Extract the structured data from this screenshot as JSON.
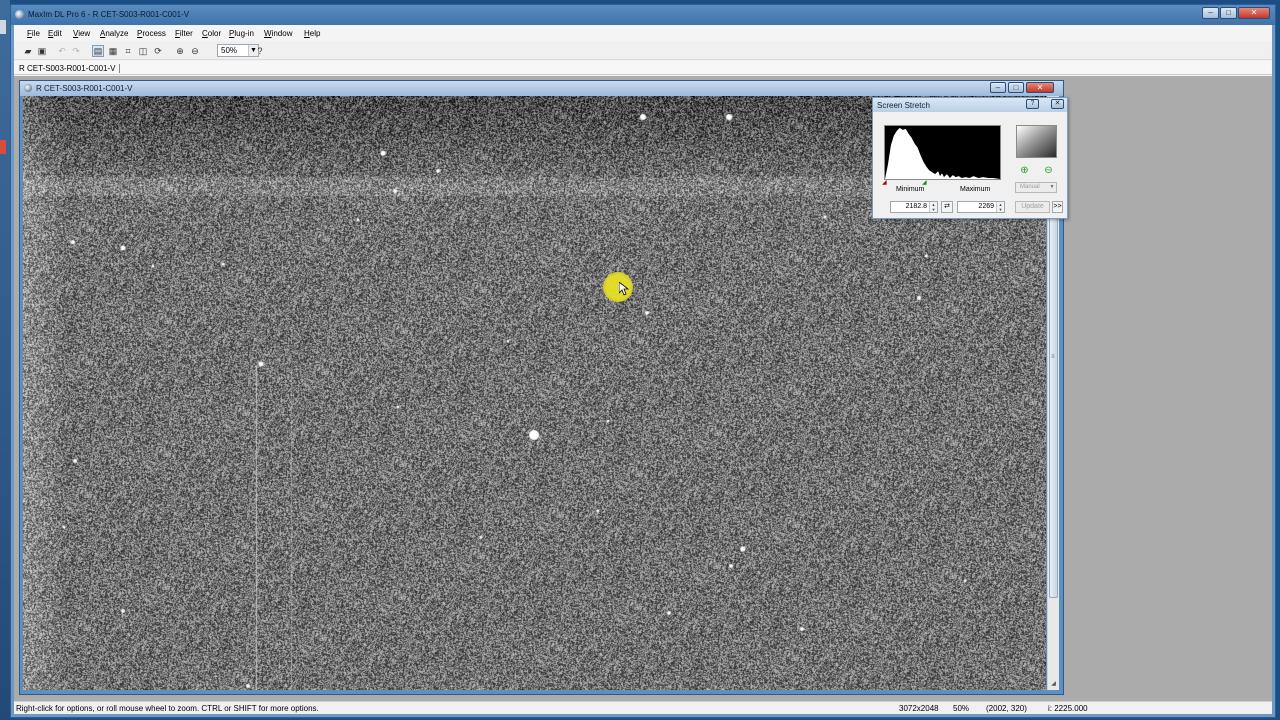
{
  "window": {
    "title": "MaxIm DL Pro 6 - R CET-S003-R001-C001-V",
    "controls": {
      "minimize": "–",
      "maximize": "□",
      "close": "✕"
    }
  },
  "menu": [
    "File",
    "Edit",
    "View",
    "Analyze",
    "Process",
    "Filter",
    "Color",
    "Plug-in",
    "Window",
    "Help"
  ],
  "toolbar": {
    "zoom_value": "50%",
    "icons": [
      "open-icon",
      "save-icon",
      "undo-icon",
      "redo-icon",
      "image-window-icon",
      "stretch-icon",
      "crop-icon",
      "flip-icon",
      "rotate-icon",
      "zoom-in-icon",
      "zoom-out-icon",
      "help-icon"
    ]
  },
  "tabs": {
    "active": "R CET-S003-R001-C001-V"
  },
  "image_window": {
    "title": "R CET-S003-R001-C001-V"
  },
  "screen_stretch": {
    "title": "Screen Stretch",
    "help": "?",
    "close": "✕",
    "minimum_label": "Minimum",
    "maximum_label": "Maximum",
    "minimum_value": "2182.8",
    "maximum_value": "2269",
    "mode": "Manual",
    "update_label": "Update",
    "expand_label": ">>",
    "swap_label": "⇄"
  },
  "status": {
    "hint": "Right-click for options, or roll mouse wheel to zoom. CTRL or SHIFT for more options.",
    "dimensions": "3072x2048",
    "zoom": "50%",
    "cursor": "(2002, 320)",
    "intensity": "i: 2225.000"
  }
}
